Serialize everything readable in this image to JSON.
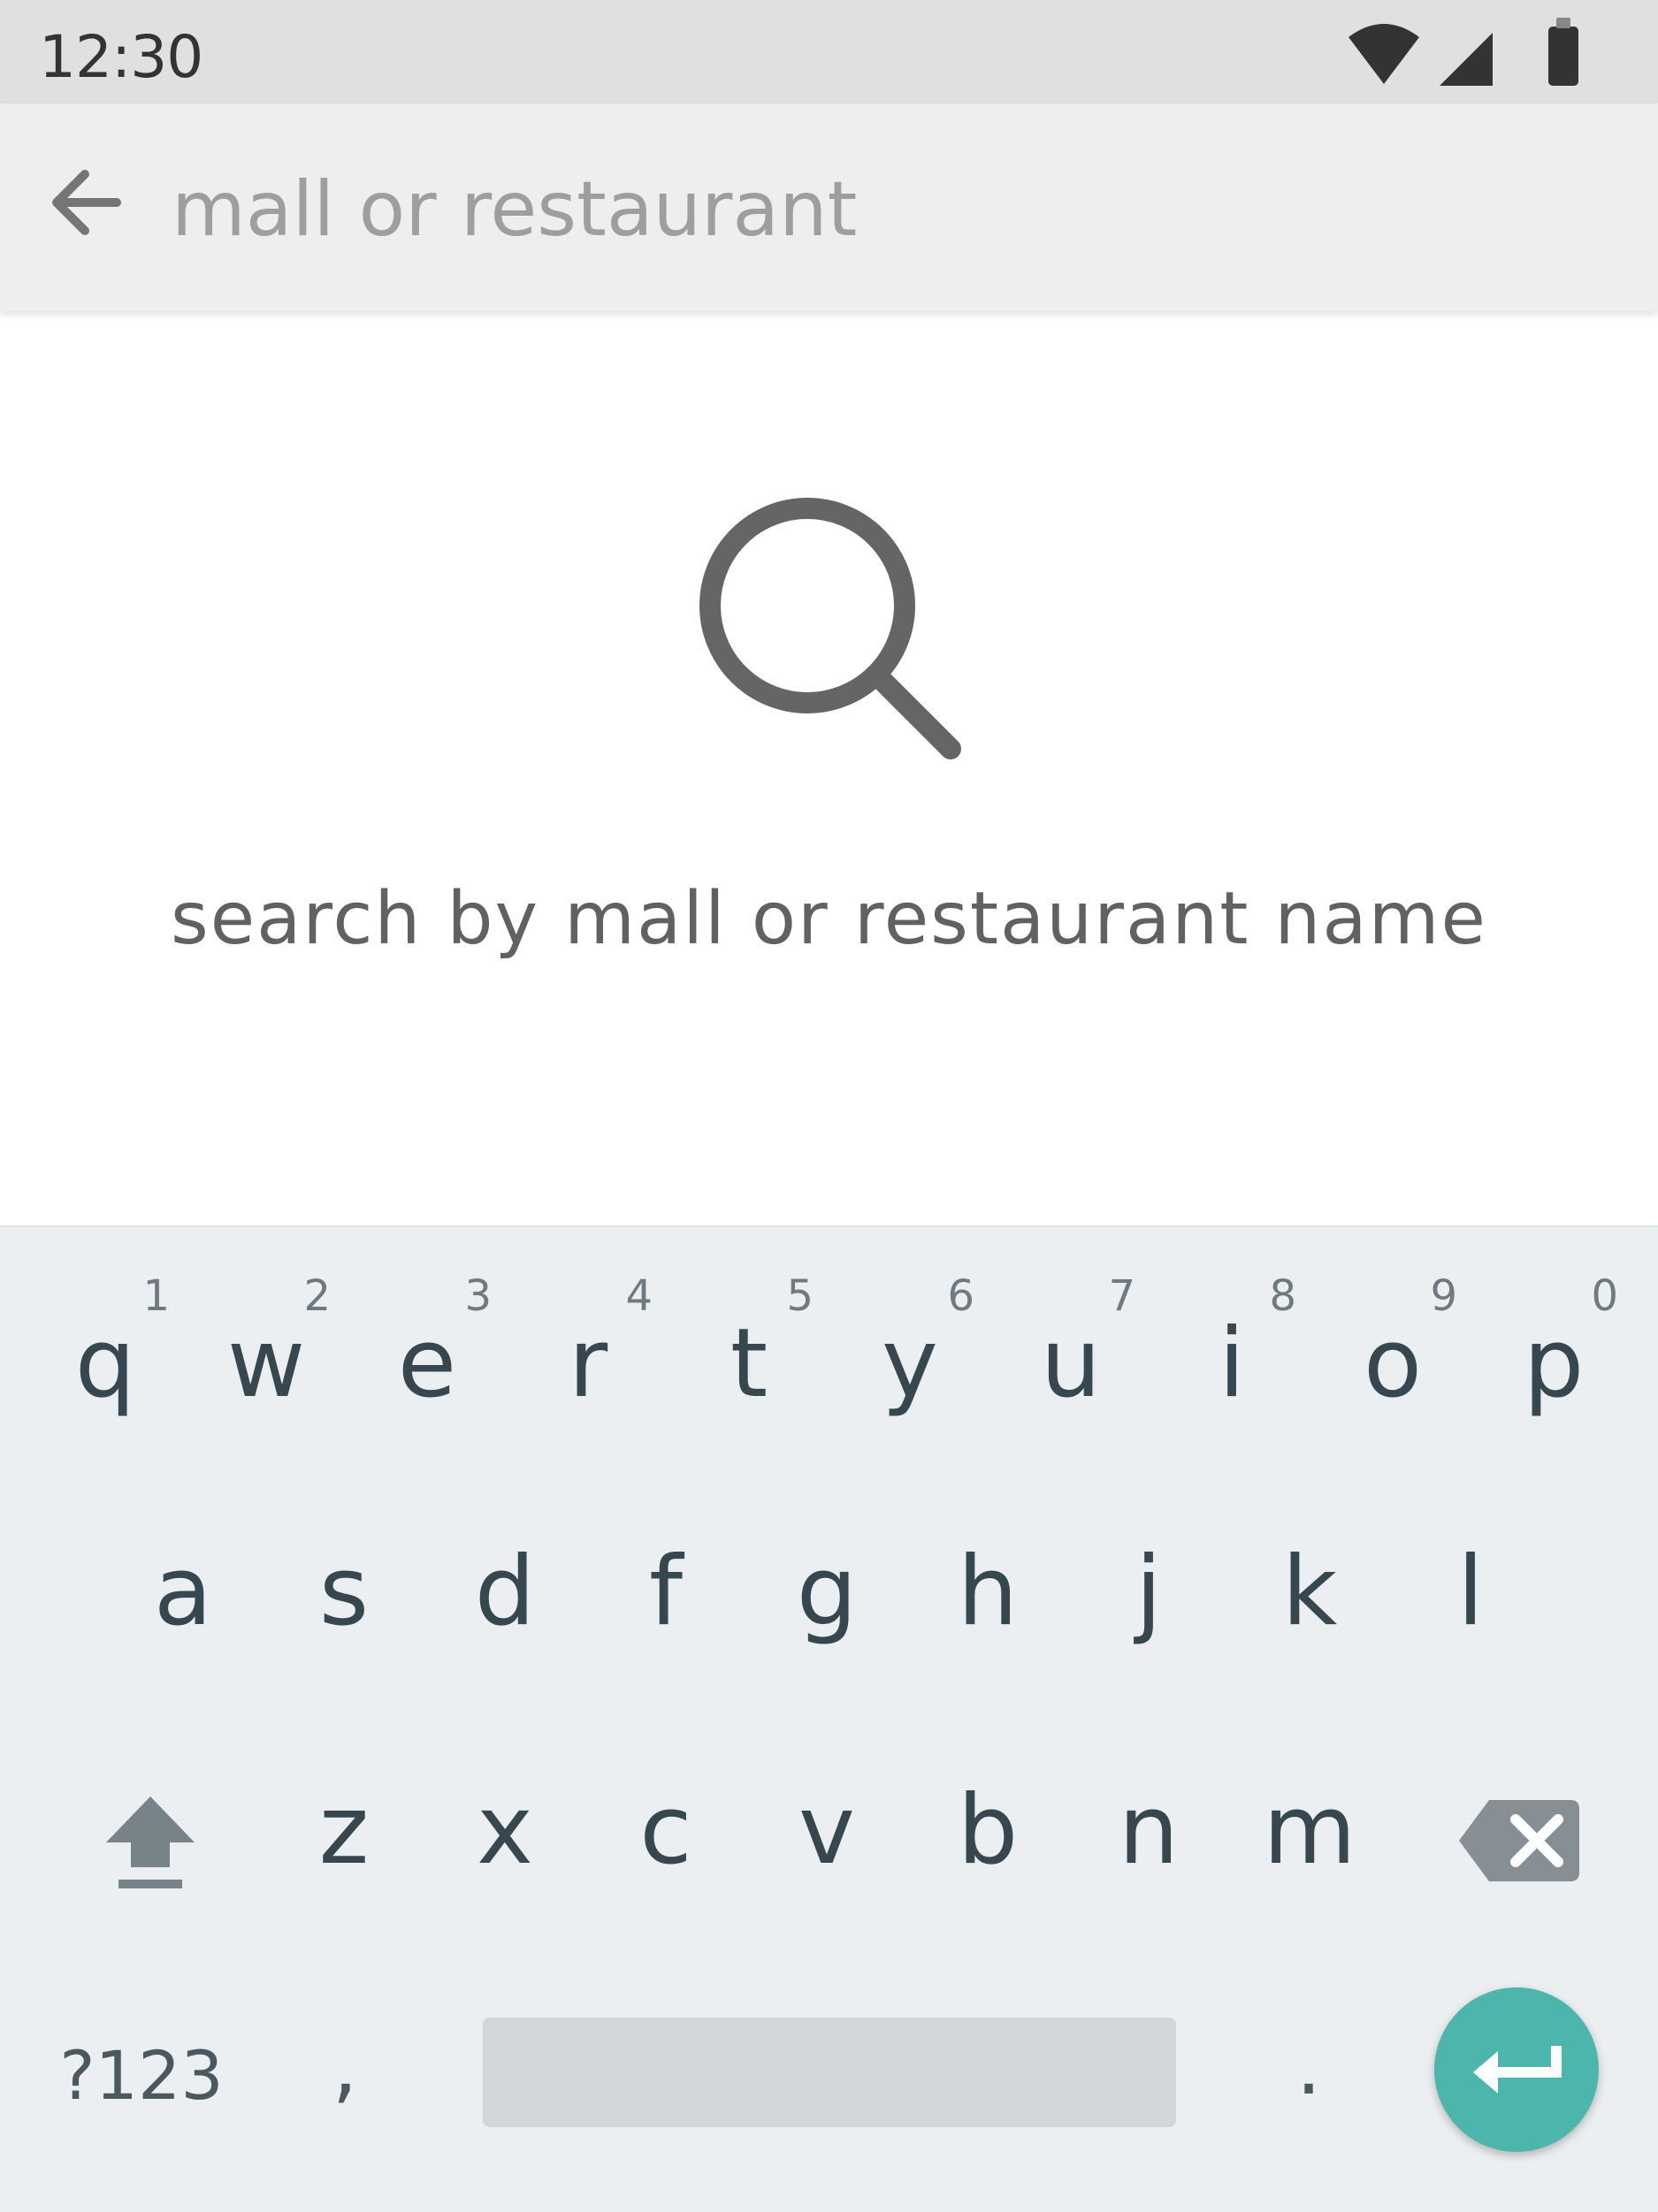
{
  "status_bar": {
    "time": "12:30",
    "icons": [
      "wifi-icon",
      "signal-icon",
      "battery-icon"
    ]
  },
  "search": {
    "placeholder": "mall or restaurant",
    "value": ""
  },
  "empty_state": {
    "icon": "search-icon",
    "message": "search by mall or restaurant name"
  },
  "keyboard": {
    "row1": [
      {
        "key": "q",
        "hint": "1"
      },
      {
        "key": "w",
        "hint": "2"
      },
      {
        "key": "e",
        "hint": "3"
      },
      {
        "key": "r",
        "hint": "4"
      },
      {
        "key": "t",
        "hint": "5"
      },
      {
        "key": "y",
        "hint": "6"
      },
      {
        "key": "u",
        "hint": "7"
      },
      {
        "key": "i",
        "hint": "8"
      },
      {
        "key": "o",
        "hint": "9"
      },
      {
        "key": "p",
        "hint": "0"
      }
    ],
    "row2": [
      "a",
      "s",
      "d",
      "f",
      "g",
      "h",
      "j",
      "k",
      "l"
    ],
    "row3": [
      "z",
      "x",
      "c",
      "v",
      "b",
      "n",
      "m"
    ],
    "symbols_label": "?123",
    "comma_label": ",",
    "period_label": ".",
    "shift_icon": "shift-icon",
    "backspace_icon": "backspace-icon",
    "enter_icon": "enter-icon"
  },
  "colors": {
    "status_bar_bg": "#e0e0e0",
    "search_bar_bg": "#eeeeee",
    "keyboard_bg": "#eceff1",
    "key_text": "#37474f",
    "accent": "#4db6ac"
  }
}
